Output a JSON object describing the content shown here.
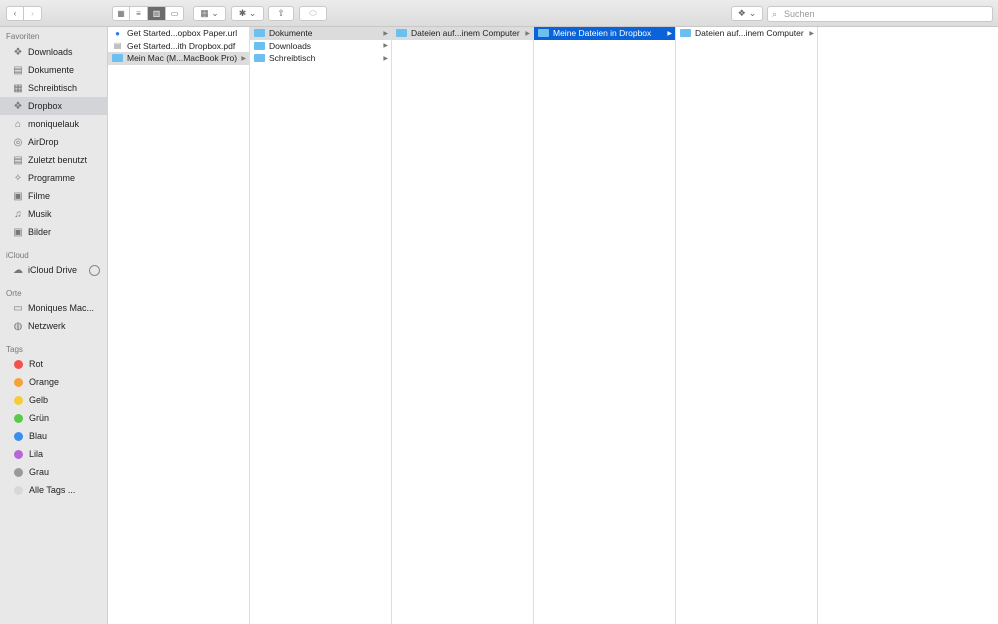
{
  "toolbar": {
    "back": "‹",
    "forward": "›",
    "view_icons": "▦",
    "view_list": "≡",
    "view_columns": "▥",
    "view_gallery": "▭",
    "group": "▦ ⌄",
    "action": "✱ ⌄",
    "share": "⇧",
    "tag": "⬭",
    "dropbox": "⌄",
    "search_placeholder": "Suchen"
  },
  "sidebar": {
    "favorites_header": "Favoriten",
    "favorites": [
      {
        "label": "Downloads",
        "icon": "❖"
      },
      {
        "label": "Dokumente",
        "icon": "▤"
      },
      {
        "label": "Schreibtisch",
        "icon": "▦"
      },
      {
        "label": "Dropbox",
        "icon": "❖"
      },
      {
        "label": "moniquelauk",
        "icon": "⌂"
      },
      {
        "label": "AirDrop",
        "icon": "◎"
      },
      {
        "label": "Zuletzt benutzt",
        "icon": "▤"
      },
      {
        "label": "Programme",
        "icon": "✧"
      },
      {
        "label": "Filme",
        "icon": "▣"
      },
      {
        "label": "Musik",
        "icon": "♫"
      },
      {
        "label": "Bilder",
        "icon": "▣"
      }
    ],
    "icloud_header": "iCloud",
    "icloud_drive": "iCloud Drive",
    "places_header": "Orte",
    "places": [
      {
        "label": "Moniques Mac...",
        "icon": "▭"
      },
      {
        "label": "Netzwerk",
        "icon": "◍"
      }
    ],
    "tags_header": "Tags",
    "tags": [
      {
        "label": "Rot",
        "color": "#f2524b"
      },
      {
        "label": "Orange",
        "color": "#f5a23a"
      },
      {
        "label": "Gelb",
        "color": "#f6cb3a"
      },
      {
        "label": "Grün",
        "color": "#5ac94b"
      },
      {
        "label": "Blau",
        "color": "#3a8ef0"
      },
      {
        "label": "Lila",
        "color": "#b867d8"
      },
      {
        "label": "Grau",
        "color": "#9a9a9a"
      },
      {
        "label": "Alle Tags ...",
        "color": "#d8d8d8"
      }
    ]
  },
  "columns": [
    [
      {
        "label": "Get Started...opbox Paper.url",
        "type": "url"
      },
      {
        "label": "Get Started...ith Dropbox.pdf",
        "type": "pdf"
      },
      {
        "label": "Mein Mac (M...MacBook Pro)",
        "type": "folder",
        "state": "gray",
        "arrow": true
      }
    ],
    [
      {
        "label": "Dokumente",
        "type": "folder",
        "state": "gray",
        "arrow": true
      },
      {
        "label": "Downloads",
        "type": "folder",
        "arrow": true
      },
      {
        "label": "Schreibtisch",
        "type": "folder",
        "arrow": true
      }
    ],
    [
      {
        "label": "Dateien auf...inem Computer",
        "type": "folder",
        "state": "gray",
        "arrow": true
      }
    ],
    [
      {
        "label": "Meine Dateien in Dropbox",
        "type": "folder",
        "state": "blue",
        "arrow": true
      }
    ],
    [
      {
        "label": "Dateien auf...inem Computer",
        "type": "folder",
        "arrow": true
      }
    ]
  ]
}
